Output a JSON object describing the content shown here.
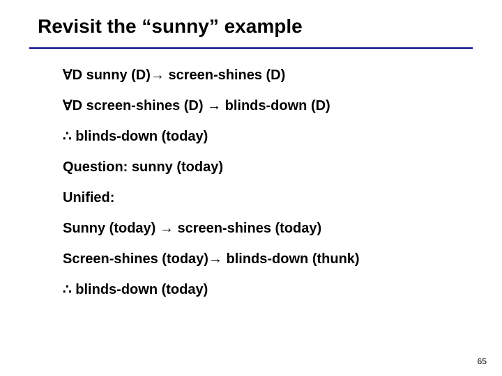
{
  "title": "Revisit the “sunny” example",
  "lines": [
    "∀D sunny (D)→ screen-shines (D)",
    "∀D screen-shines (D) → blinds-down (D)",
    "∴ blinds-down (today)",
    "Question: sunny (today)",
    "Unified:",
    "Sunny (today) → screen-shines (today)",
    "Screen-shines (today)→ blinds-down (thunk)",
    "∴ blinds-down (today)"
  ],
  "page_number": "65"
}
